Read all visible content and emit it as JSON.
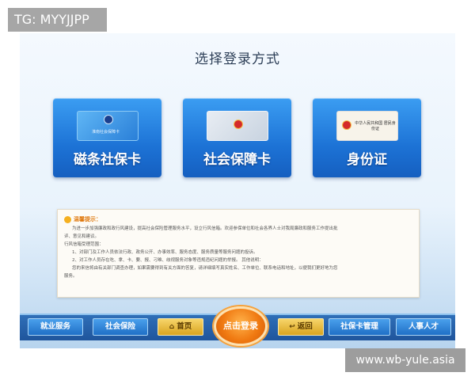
{
  "badge": {
    "text": "TG: MYYJJPP"
  },
  "watermark": {
    "text": "www.wb-yule.asia"
  },
  "header": {
    "title": "选择登录方式"
  },
  "cards": [
    {
      "label": "磁条社保卡",
      "icon": "social-security-card-icon",
      "mini_text": "淮南社会保障卡"
    },
    {
      "label": "社会保障卡",
      "icon": "social-insurance-card-icon",
      "mini_text": ""
    },
    {
      "label": "身份证",
      "icon": "id-card-icon",
      "mini_text": "中华人民共和国 居民身份证"
    }
  ],
  "notice": {
    "title": "温馨提示：",
    "lines": [
      "为进一步加强廉政和政行风建设，提高社会保险管理服务水平，设立行风信箱。欢迎参保单位和社会各界人士对我局廉政和服务工作提出批",
      "评、意见和建议。",
      "行风信箱受理范围：",
      "1、对部门及工作人员依法行政、政务公开、办事效率、服务态度、服务质量等服务问题的投诉。",
      "2、对工作人员存在吃、拿、卡、要、报、刁难、歧视服务对象等违规违纪问题的举报。 其他说明：",
      "您的来信将由有关部门调查办理，如果需要得到有关方面的答复，请详细填写真实姓名、工作单位、联系电话和地址，以便我们更好地为您",
      "服务。"
    ]
  },
  "nav": {
    "employment": "就业服务",
    "social_insurance": "社会保险",
    "home": "首页",
    "login": "点击登录",
    "back": "返回",
    "card_management": "社保卡管理",
    "hr_talent": "人事人才"
  },
  "colors": {
    "card_blue": "#1d73d6",
    "nav_blue": "#1f559c",
    "accent_orange": "#f07a12",
    "gold": "#d9a420"
  }
}
